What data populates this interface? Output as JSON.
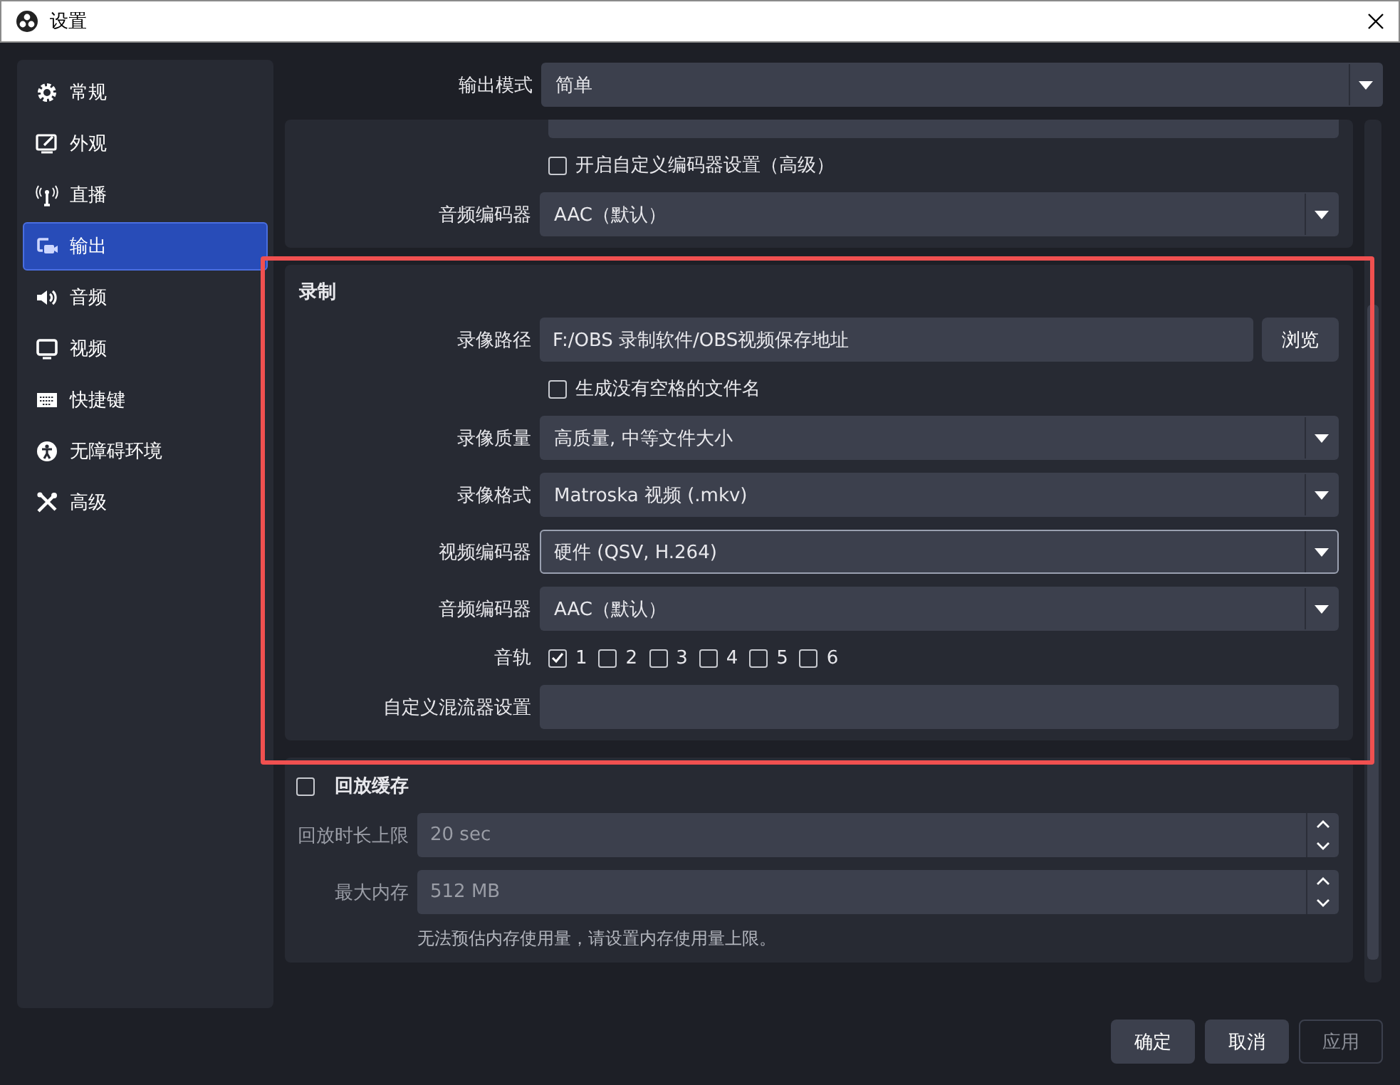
{
  "window": {
    "title": "设置"
  },
  "sidebar": {
    "items": [
      {
        "label": "常规",
        "selected": false
      },
      {
        "label": "外观",
        "selected": false
      },
      {
        "label": "直播",
        "selected": false
      },
      {
        "label": "输出",
        "selected": true
      },
      {
        "label": "音频",
        "selected": false
      },
      {
        "label": "视频",
        "selected": false
      },
      {
        "label": "快捷键",
        "selected": false
      },
      {
        "label": "无障碍环境",
        "selected": false
      },
      {
        "label": "高级",
        "selected": false
      }
    ]
  },
  "output_mode": {
    "label": "输出模式",
    "value": "简单"
  },
  "streaming_group": {
    "custom_encoder": {
      "label": "开启自定义编码器设置（高级）",
      "checked": false
    },
    "audio_encoder": {
      "label": "音频编码器",
      "value": "AAC（默认）"
    }
  },
  "recording": {
    "title": "录制",
    "fields": [
      {
        "kind": "path",
        "label": "录像路径",
        "value": "F:/OBS 录制软件/OBS视频保存地址",
        "button": "浏览"
      },
      {
        "kind": "checkbox",
        "label": "生成没有空格的文件名",
        "checked": false
      },
      {
        "kind": "combo",
        "label": "录像质量",
        "value": "高质量, 中等文件大小",
        "focused": false
      },
      {
        "kind": "combo",
        "label": "录像格式",
        "value": "Matroska 视频 (.mkv)",
        "focused": false
      },
      {
        "kind": "combo",
        "label": "视频编码器",
        "value": "硬件 (QSV, H.264)",
        "focused": true
      },
      {
        "kind": "combo",
        "label": "音频编码器",
        "value": "AAC（默认）",
        "focused": false
      },
      {
        "kind": "tracks",
        "label": "音轨",
        "tracks": [
          {
            "label": "1",
            "checked": true
          },
          {
            "label": "2",
            "checked": false
          },
          {
            "label": "3",
            "checked": false
          },
          {
            "label": "4",
            "checked": false
          },
          {
            "label": "5",
            "checked": false
          },
          {
            "label": "6",
            "checked": false
          }
        ]
      },
      {
        "kind": "text",
        "label": "自定义混流器设置"
      }
    ]
  },
  "replay_buffer": {
    "title": "回放缓存",
    "enabled": false,
    "fields": [
      {
        "label": "回放时长上限",
        "value": "20 sec"
      },
      {
        "label": "最大内存",
        "value": "512 MB"
      }
    ],
    "note": "无法预估内存使用量，请设置内存使用量上限。"
  },
  "buttons": [
    {
      "label": "确定",
      "disabled": false
    },
    {
      "label": "取消",
      "disabled": false
    },
    {
      "label": "应用",
      "disabled": true
    }
  ]
}
